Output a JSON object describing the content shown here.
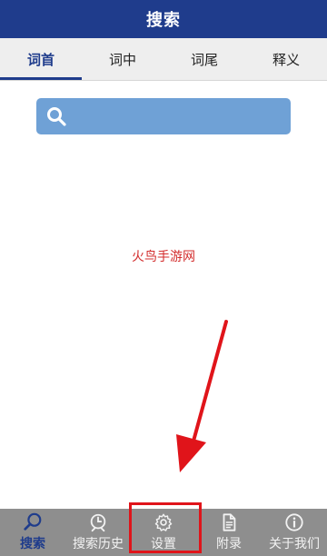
{
  "header": {
    "title": "搜索"
  },
  "tabs": [
    {
      "label": "词首",
      "active": true
    },
    {
      "label": "词中"
    },
    {
      "label": "词尾"
    },
    {
      "label": "释义"
    }
  ],
  "search": {
    "placeholder": "",
    "icon": "search-icon"
  },
  "watermark": "火鸟手游网",
  "bottom_nav": [
    {
      "label": "搜索",
      "icon": "search-icon",
      "active": true
    },
    {
      "label": "搜索历史",
      "icon": "history-icon"
    },
    {
      "label": "设置",
      "icon": "gear-icon"
    },
    {
      "label": "附录",
      "icon": "document-icon"
    },
    {
      "label": "关于我们",
      "icon": "info-icon"
    }
  ],
  "colors": {
    "primary": "#1f3c8c",
    "search_bg": "#6fa1d6",
    "annotation": "#e0141a",
    "nav_bg": "#8e8e8e"
  }
}
